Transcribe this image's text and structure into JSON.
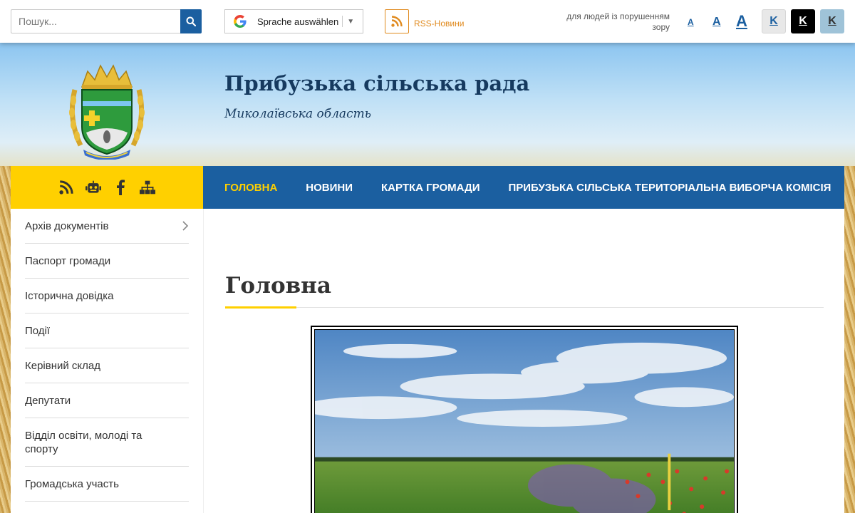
{
  "topbar": {
    "search_placeholder": "Пошук...",
    "translate_label": "Sprache auswählen",
    "translate_arrow": "▼",
    "rss_label": "RSS-Новини",
    "vision_text": "для людей із порушенням зору",
    "font_sizes": [
      "A",
      "A",
      "A"
    ],
    "contrast_buttons": [
      "K",
      "K",
      "K"
    ]
  },
  "header": {
    "title": "Прибузька сільська рада",
    "subtitle": "Миколаївська область"
  },
  "nav": {
    "items": [
      {
        "label": "ГОЛОВНА",
        "active": true
      },
      {
        "label": "НОВИНИ",
        "active": false
      },
      {
        "label": "КАРТКА ГРОМАДИ",
        "active": false
      },
      {
        "label": "ПРИБУЗЬКА СІЛЬСЬКА ТЕРИТОРІАЛЬНА ВИБОРЧА КОМІСІЯ",
        "active": false
      }
    ]
  },
  "social": {
    "icons": [
      "rss-icon",
      "robot-icon",
      "facebook-icon",
      "sitemap-icon"
    ]
  },
  "sidebar": {
    "items": [
      {
        "label": "Архів документів"
      },
      {
        "label": "Паспорт громади"
      },
      {
        "label": "Історична довідка"
      },
      {
        "label": "Події"
      },
      {
        "label": "Керівний склад"
      },
      {
        "label": "Депутати"
      },
      {
        "label": "Відділ освіти, молоді та спорту"
      },
      {
        "label": "Громадська участь"
      }
    ]
  },
  "main": {
    "heading": "Головна"
  },
  "colors": {
    "primary": "#1b5fa0",
    "accent": "#ffd000",
    "rss": "#e08a1e",
    "title": "#163a5f"
  }
}
